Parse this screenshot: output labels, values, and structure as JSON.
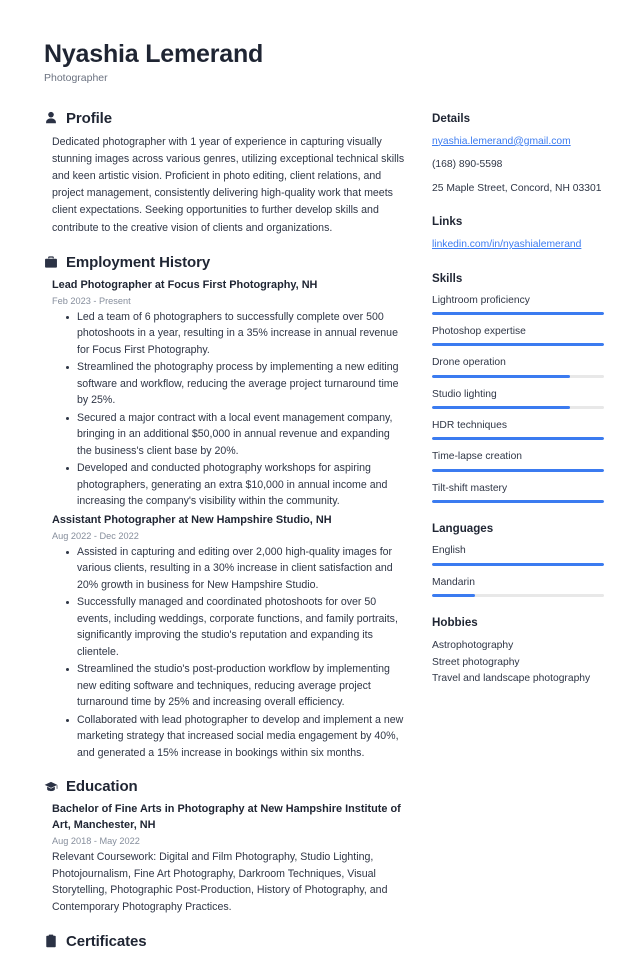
{
  "header": {
    "name": "Nyashia Lemerand",
    "title": "Photographer"
  },
  "main": {
    "profile": {
      "icon": "user-icon",
      "heading": "Profile",
      "text": "Dedicated photographer with 1 year of experience in capturing visually stunning images across various genres, utilizing exceptional technical skills and keen artistic vision. Proficient in photo editing, client relations, and project management, consistently delivering high-quality work that meets client expectations. Seeking opportunities to further develop skills and contribute to the creative vision of clients and organizations."
    },
    "employment": {
      "icon": "briefcase-icon",
      "heading": "Employment History",
      "entries": [
        {
          "title": "Lead Photographer at Focus First Photography, NH",
          "date": "Feb 2023 - Present",
          "bullets": [
            "Led a team of 6 photographers to successfully complete over 500 photoshoots in a year, resulting in a 35% increase in annual revenue for Focus First Photography.",
            "Streamlined the photography process by implementing a new editing software and workflow, reducing the average project turnaround time by 25%.",
            "Secured a major contract with a local event management company, bringing in an additional $50,000 in annual revenue and expanding the business's client base by 20%.",
            "Developed and conducted photography workshops for aspiring photographers, generating an extra $10,000 in annual income and increasing the company's visibility within the community."
          ]
        },
        {
          "title": "Assistant Photographer at New Hampshire Studio, NH",
          "date": "Aug 2022 - Dec 2022",
          "bullets": [
            "Assisted in capturing and editing over 2,000 high-quality images for various clients, resulting in a 30% increase in client satisfaction and 20% growth in business for New Hampshire Studio.",
            "Successfully managed and coordinated photoshoots for over 50 events, including weddings, corporate functions, and family portraits, significantly improving the studio's reputation and expanding its clientele.",
            "Streamlined the studio's post-production workflow by implementing new editing software and techniques, reducing average project turnaround time by 25% and increasing overall efficiency.",
            "Collaborated with lead photographer to develop and implement a new marketing strategy that increased social media engagement by 40%, and generated a 15% increase in bookings within six months."
          ]
        }
      ]
    },
    "education": {
      "icon": "graduation-cap-icon",
      "heading": "Education",
      "entries": [
        {
          "title": "Bachelor of Fine Arts in Photography at New Hampshire Institute of Art, Manchester, NH",
          "date": "Aug 2018 - May 2022",
          "description": "Relevant Coursework: Digital and Film Photography, Studio Lighting, Photojournalism, Fine Art Photography, Darkroom Techniques, Visual Storytelling, Photographic Post-Production, History of Photography, and Contemporary Photography Practices."
        }
      ]
    },
    "certificates": {
      "icon": "clipboard-icon",
      "heading": "Certificates"
    }
  },
  "sidebar": {
    "details": {
      "heading": "Details",
      "email": "nyashia.lemerand@gmail.com",
      "phone": "(168) 890-5598",
      "address": "25 Maple Street, Concord, NH 03301"
    },
    "links": {
      "heading": "Links",
      "items": [
        {
          "label": "linkedin.com/in/nyashialemerand"
        }
      ]
    },
    "skills": {
      "heading": "Skills",
      "items": [
        {
          "label": "Lightroom proficiency",
          "level": 100
        },
        {
          "label": "Photoshop expertise",
          "level": 100
        },
        {
          "label": "Drone operation",
          "level": 80
        },
        {
          "label": "Studio lighting",
          "level": 80
        },
        {
          "label": "HDR techniques",
          "level": 100
        },
        {
          "label": "Time-lapse creation",
          "level": 100
        },
        {
          "label": "Tilt-shift mastery",
          "level": 100
        }
      ]
    },
    "languages": {
      "heading": "Languages",
      "items": [
        {
          "label": "English",
          "level": 100
        },
        {
          "label": "Mandarin",
          "level": 25
        }
      ]
    },
    "hobbies": {
      "heading": "Hobbies",
      "items": [
        {
          "label": "Astrophotography"
        },
        {
          "label": "Street photography"
        },
        {
          "label": "Travel and landscape photography"
        }
      ]
    }
  },
  "theme": {
    "accent": "#3b7bf0",
    "track": "#e8e8e8",
    "text": "#2f3646",
    "muted": "#868e9c"
  }
}
